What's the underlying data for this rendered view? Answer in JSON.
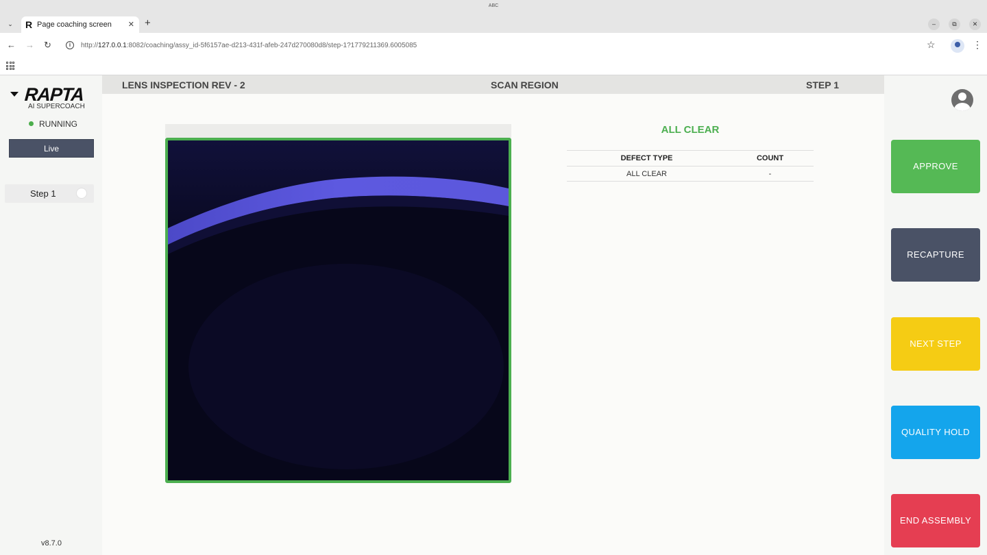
{
  "os_bar": {
    "title": "ABC"
  },
  "browser": {
    "tab": {
      "favicon": "R",
      "title": "Page coaching screen"
    },
    "url": {
      "host": "127.0.0.1",
      "full_prefix": "http://",
      "rest": ":8082/coaching/assy_id-5f6157ae-d213-431f-afeb-247d270080d8/step-1?1779211369.6005085"
    }
  },
  "sidebar": {
    "logo": "RAPTA",
    "logo_sub": "AI SUPERCOACH",
    "status": "RUNNING",
    "live_label": "Live",
    "steps": [
      {
        "label": "Step 1"
      }
    ],
    "version": "v8.7.0"
  },
  "header": {
    "left": "LENS INSPECTION REV - 2",
    "center": "SCAN REGION",
    "right": "STEP 1"
  },
  "result": {
    "title": "ALL CLEAR",
    "table": {
      "headers": [
        "DEFECT TYPE",
        "COUNT"
      ],
      "rows": [
        [
          "ALL CLEAR",
          "-"
        ]
      ]
    }
  },
  "actions": {
    "approve": "APPROVE",
    "recapture": "RECAPTURE",
    "next_step": "NEXT STEP",
    "quality_hold": "QUALITY HOLD",
    "end_assembly": "END ASSEMBLY"
  },
  "colors": {
    "accent_green": "#4caf50",
    "approve": "#55b955",
    "recapture": "#4a5266",
    "next_step": "#f5cc14",
    "quality_hold": "#14a5ec",
    "end_assembly": "#e53e52"
  }
}
